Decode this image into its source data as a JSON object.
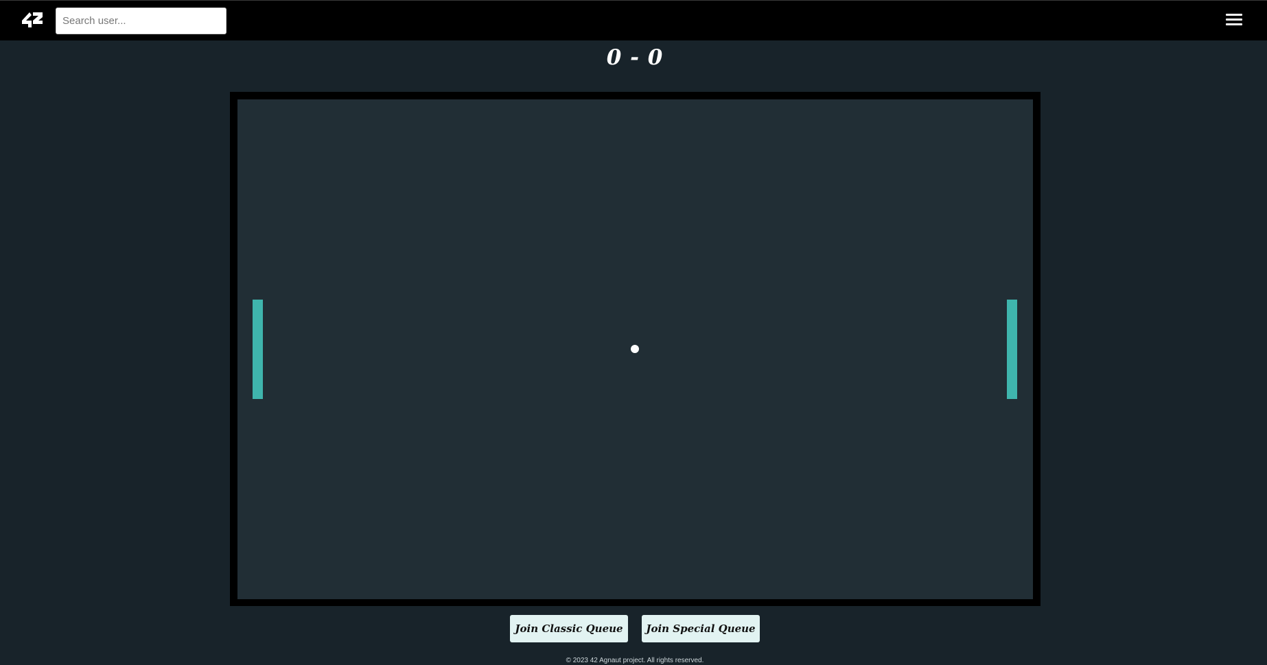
{
  "header": {
    "logo_text": "42",
    "search": {
      "placeholder": "Search user...",
      "value": ""
    },
    "menu_icon": "hamburger-menu-icon"
  },
  "game": {
    "score": "0 - 0",
    "paddle_color": "#3fb5ad",
    "ball_color": "#ffffff",
    "arena_color": "#212e35",
    "frame_color": "#000000"
  },
  "actions": {
    "classic_queue_label": "Join Classic Queue",
    "special_queue_label": "Join Special Queue"
  },
  "footer": {
    "text": "© 2023 42 Agnaut project. All rights reserved."
  },
  "colors": {
    "page_background": "#18232a",
    "topbar_background": "#000000",
    "button_background": "#e2f3f2"
  }
}
